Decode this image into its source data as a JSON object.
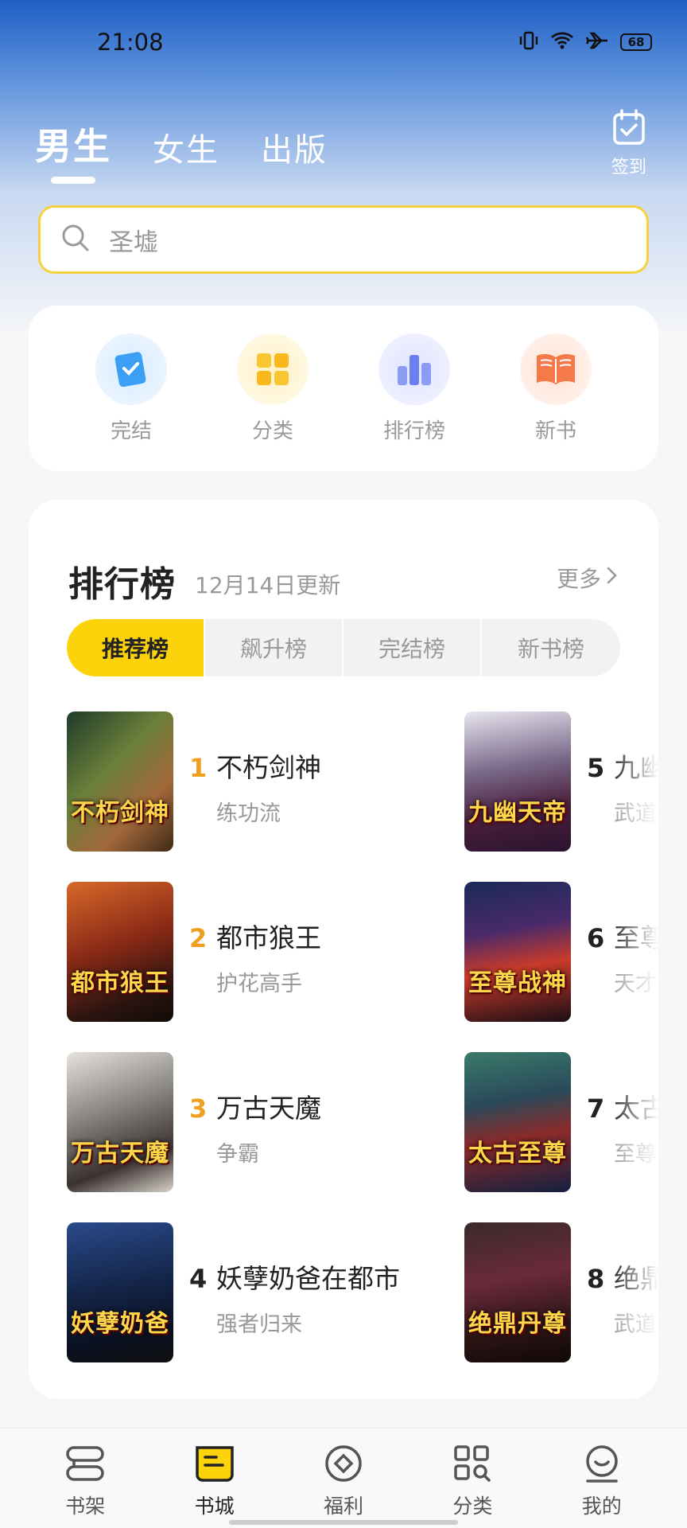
{
  "status": {
    "time": "21:08",
    "battery": "68"
  },
  "top_tabs": [
    {
      "label": "男生",
      "active": true
    },
    {
      "label": "女生",
      "active": false
    },
    {
      "label": "出版",
      "active": false
    }
  ],
  "signin": {
    "label": "签到",
    "icon": "calendar-check-icon"
  },
  "search": {
    "placeholder": "圣墟",
    "icon": "search-icon"
  },
  "quick_links": [
    {
      "label": "完结",
      "icon": "bookmark-book-icon",
      "color": "#3ba0f5"
    },
    {
      "label": "分类",
      "icon": "grid-tiles-icon",
      "color": "#f7c630"
    },
    {
      "label": "排行榜",
      "icon": "bar-chart-icon",
      "color": "#7b8ff2"
    },
    {
      "label": "新书",
      "icon": "open-book-icon",
      "color": "#f57a4a"
    }
  ],
  "ranking": {
    "title": "排行榜",
    "updated": "12月14日更新",
    "more": "更多",
    "tabs": [
      "推荐榜",
      "飙升榜",
      "完结榜",
      "新书榜"
    ],
    "active_tab": "推荐榜",
    "books": [
      {
        "rank": "1",
        "title": "不朽剑神",
        "genre": "练功流",
        "cover_text": "不朽剑神"
      },
      {
        "rank": "2",
        "title": "都市狼王",
        "genre": "护花高手",
        "cover_text": "都市狼王"
      },
      {
        "rank": "3",
        "title": "万古天魔",
        "genre": "争霸",
        "cover_text": "万古天魔"
      },
      {
        "rank": "4",
        "title": "妖孽奶爸在都市",
        "genre": "强者归来",
        "cover_text": "妖孽奶爸"
      },
      {
        "rank": "5",
        "title": "九幽",
        "genre": "武道",
        "cover_text": "九幽天帝"
      },
      {
        "rank": "6",
        "title": "至尊",
        "genre": "天才",
        "cover_text": "至尊战神"
      },
      {
        "rank": "7",
        "title": "太古",
        "genre": "至尊",
        "cover_text": "太古至尊"
      },
      {
        "rank": "8",
        "title": "绝鼎",
        "genre": "武道",
        "cover_text": "绝鼎丹尊"
      }
    ]
  },
  "bottom_nav": [
    {
      "label": "书架",
      "icon": "bookshelf-icon",
      "active": false
    },
    {
      "label": "书城",
      "icon": "bookstore-icon",
      "active": true
    },
    {
      "label": "福利",
      "icon": "coin-icon",
      "active": false
    },
    {
      "label": "分类",
      "icon": "category-search-icon",
      "active": false
    },
    {
      "label": "我的",
      "icon": "profile-icon",
      "active": false
    }
  ]
}
